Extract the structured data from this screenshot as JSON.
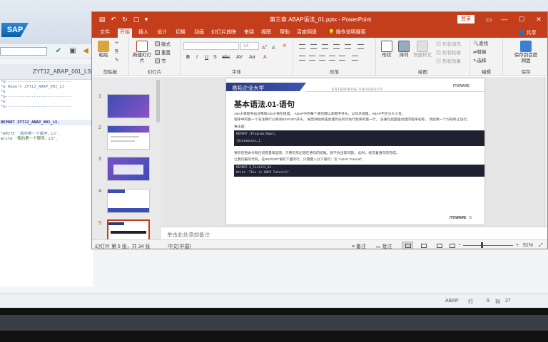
{
  "sap": {
    "logo": "SAP",
    "program_name": "ZYT12_ABAP_001_LS",
    "editor_lines": [
      {
        "text": "*&----------------------------",
        "kind": "comment"
      },
      {
        "text": "*& Report  ZYT12_ABAP_001_LS",
        "kind": "comment"
      },
      {
        "text": "*&",
        "kind": "comment"
      },
      {
        "text": "*&----------------------------",
        "kind": "comment"
      },
      {
        "text": "*&",
        "kind": "comment"
      },
      {
        "text": "*&----------------------------",
        "kind": "comment"
      },
      {
        "text": "",
        "kind": "plain"
      },
      {
        "text": "REPORT  ZYT12_ABAP_001_LS.",
        "kind": "keyword"
      },
      {
        "text": "",
        "kind": "plain"
      },
      {
        "text": "*WRITE '我的第一个程序，LS'.",
        "kind": "comment"
      },
      {
        "text": "write '我的第一个程序，LS'.",
        "kind": "string"
      }
    ],
    "status": {
      "system": "ABAP",
      "row_label": "行",
      "row": "9",
      "col_label": "列",
      "col": "27"
    }
  },
  "ppt": {
    "title": "第三章 ABAP语法_01.pptx - PowerPoint",
    "login": "登录",
    "tabs": [
      "文件",
      "开始",
      "插入",
      "设计",
      "切换",
      "动画",
      "幻灯片放映",
      "审阅",
      "视图",
      "帮助",
      "百度网盘",
      "操作说明搜索"
    ],
    "share": "共享",
    "ribbon": {
      "clipboard": {
        "paste": "粘贴",
        "label": "剪贴板"
      },
      "slides": {
        "new_slide": "新建幻灯片",
        "layout": "版式",
        "reset": "重置",
        "section": "节",
        "label": "幻灯片"
      },
      "font": {
        "label": "字体",
        "size": "14"
      },
      "paragraph": {
        "label": "段落"
      },
      "drawing": {
        "shapes": "形状",
        "arrange": "排列",
        "quick_styles": "快速样式",
        "fill": "形状填充",
        "outline": "形状轮廓",
        "effects": "形状效果",
        "label": "绘图"
      },
      "editing": {
        "find": "查找",
        "replace": "替换",
        "select": "选择",
        "label": "编辑"
      },
      "save": {
        "button": "保存到百度网盘",
        "label": "保存"
      }
    },
    "thumbnails": [
      {
        "num": "1",
        "selected": false
      },
      {
        "num": "2",
        "selected": false
      },
      {
        "num": "3",
        "selected": false
      },
      {
        "num": "4",
        "selected": false
      },
      {
        "num": "5",
        "selected": true
      }
    ],
    "slide": {
      "university": "易拓企业大学",
      "enterprise": "ENTERPRISE UNIVERSITY",
      "brand": "ITOWARE",
      "title": "基本语法.01-语句",
      "p1": "ABAP源程序由注释和ABAP语句组成。 ABAP中的每个语句都以关键字开头，以句点结尾，ABAP不区分大小写。",
      "p2": "程序中的第一个非注释行以单词REPORT开头。 报告将始终是创建的任何可执行程序的第一行。 该语句后面是创建的程序名称， 然后用一个句号终止该行。",
      "p3": "语法是：",
      "code1_line1": "REPORT [Program_Name].",
      "code1_line2": "[Statements…].",
      "p4": "语句包括命令和任何变量和选项，只要句号出现在语句的结尾，就不会出现问题。 此时，标志着语句的完成。",
      "p5": "让我们编写代码。在REPORT语句下面的行，只需键入以下语句：写 \"ABAP Tutorial\"。",
      "code2_line1": "REPORT Z_Test123_01.",
      "code2_line2": "Write 'This is ABAP Tutorial'.",
      "footer_brand": "ITOWARE",
      "page_number": "5"
    },
    "notes_placeholder": "单击此处添加备注",
    "status": {
      "slide_info": "幻灯片 第 5 张，共 34 张",
      "language": "中文(中国)",
      "notes_btn": "备注",
      "comments_btn": "批注",
      "zoom": "51%"
    }
  }
}
